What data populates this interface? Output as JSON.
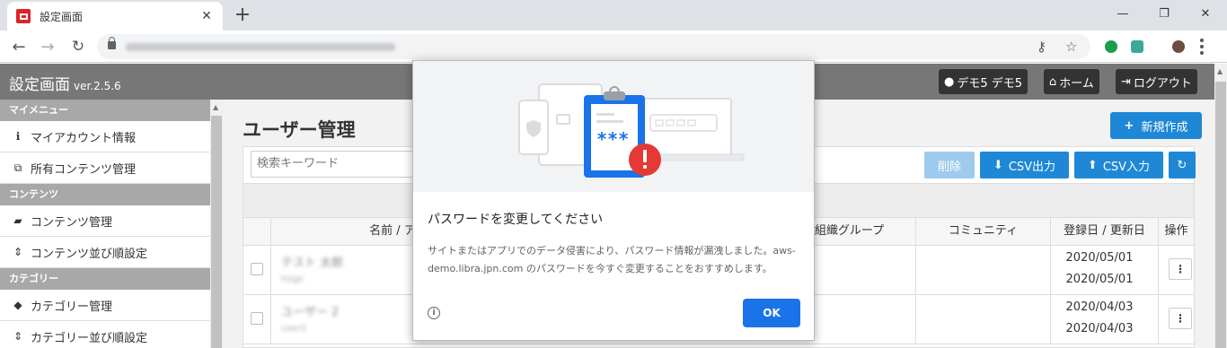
{
  "browser": {
    "tab_title": "設定画面",
    "tab_close": "✕",
    "new_tab": "+",
    "win_min": "—",
    "win_max": "❐",
    "win_close": "✕"
  },
  "header": {
    "title": "設定画面",
    "version": "ver.2.5.6",
    "user_label": "デモ5 デモ5",
    "home_label": "ホーム",
    "logout_label": "ログアウト"
  },
  "sidebar": {
    "sections": [
      {
        "title": "マイメニュー",
        "items": [
          {
            "label": "マイアカウント情報",
            "icon": "info-icon"
          },
          {
            "label": "所有コンテンツ管理",
            "icon": "copy-icon"
          }
        ]
      },
      {
        "title": "コンテンツ",
        "items": [
          {
            "label": "コンテンツ管理",
            "icon": "book-icon"
          },
          {
            "label": "コンテンツ並び順設定",
            "icon": "sort-icon"
          }
        ]
      },
      {
        "title": "カテゴリー",
        "items": [
          {
            "label": "カテゴリー管理",
            "icon": "tags-icon"
          },
          {
            "label": "カテゴリー並び順設定",
            "icon": "sort-icon"
          }
        ]
      }
    ]
  },
  "main": {
    "title": "ユーザー管理",
    "new_button": "新規作成",
    "search_placeholder": "検索キーワード",
    "delete_button": "削除",
    "csv_export": "CSV出力",
    "csv_import": "CSV入力",
    "columns": {
      "name": "名前 / アカウン",
      "group": "組織グループ",
      "community": "コミュニティ",
      "dates": "登録日 / 更新日",
      "actions": "操作"
    },
    "rows": [
      {
        "name": "テスト 太郎",
        "sub": "hoge",
        "registered": "2020/05/01",
        "updated": "2020/05/01"
      },
      {
        "name": "ユーザー 2",
        "sub": "user2",
        "registered": "2020/04/03",
        "updated": "2020/04/03"
      }
    ]
  },
  "dialog": {
    "title": "パスワードを変更してください",
    "body": "サイトまたはアプリでのデータ侵害により、パスワード情報が漏洩しました。aws-demo.libra.jpn.com のパスワードを今すぐ変更することをおすすめします。",
    "password_mask": "***",
    "ok": "OK"
  },
  "colors": {
    "accent": "#1e88d6",
    "header_bg": "#777777",
    "dialog_ok": "#1a73e8",
    "alert_red": "#e53935"
  }
}
